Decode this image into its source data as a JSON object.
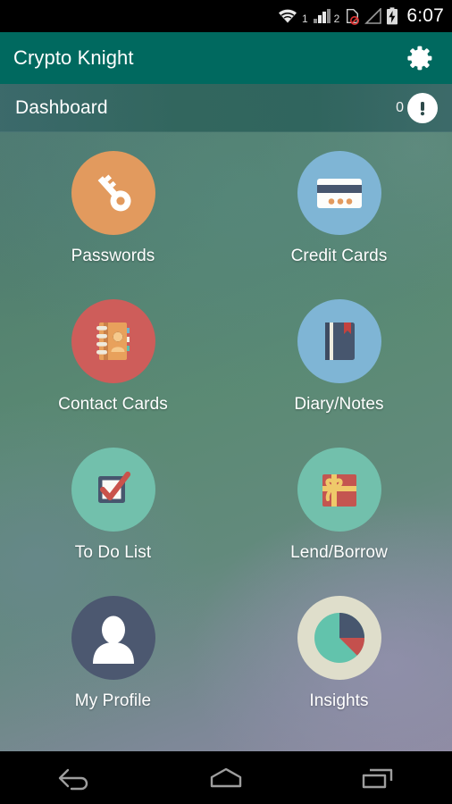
{
  "status_bar": {
    "wifi_icon": "wifi-icon",
    "sim1_label": "1",
    "sim1_signal_icon": "signal-bars-icon",
    "sim2_label": "2",
    "sim2_nosim_icon": "no-sim-card-icon",
    "signal2_icon": "signal-triangle-icon",
    "battery_icon": "battery-charging-icon",
    "clock": "6:07",
    "background_color": "#000000"
  },
  "action_bar": {
    "title": "Crypto Knight",
    "settings_icon": "gear-icon",
    "background_color": "#00695F",
    "text_color": "#FFFFFF"
  },
  "sub_header": {
    "title": "Dashboard",
    "badge_count": "0",
    "alert_icon": "exclamation-circle-icon"
  },
  "dashboard": {
    "tiles": [
      {
        "label": "Passwords",
        "icon": "key-icon",
        "circle_color": "#E29A5E",
        "glyph_color": "#FFFFFF"
      },
      {
        "label": "Credit Cards",
        "icon": "credit-card-icon",
        "circle_color": "#7FB5D5",
        "glyph_color": "#FDFDFB"
      },
      {
        "label": "Contact Cards",
        "icon": "address-book-icon",
        "circle_color": "#CE5D5A",
        "glyph_color": "#E8A15C"
      },
      {
        "label": "Diary/Notes",
        "icon": "notebook-bookmark-icon",
        "circle_color": "#7FB5D5",
        "glyph_color": "#47566E"
      },
      {
        "label": "To Do List",
        "icon": "checkbox-checked-icon",
        "circle_color": "#72C0AC",
        "glyph_color": "#C9524B"
      },
      {
        "label": "Lend/Borrow",
        "icon": "gift-box-icon",
        "circle_color": "#72C0AC",
        "glyph_color": "#C45550"
      },
      {
        "label": "My Profile",
        "icon": "person-avatar-icon",
        "circle_color": "#4C5870",
        "glyph_color": "#FFFFFF"
      },
      {
        "label": "Insights",
        "icon": "pie-chart-icon",
        "circle_color": "#DFDECB",
        "glyph_color": "#62C3AC"
      }
    ]
  },
  "nav_bar": {
    "back_icon": "back-arrow-icon",
    "home_icon": "home-icon",
    "recents_icon": "recent-apps-icon",
    "background_color": "#000000",
    "icon_color": "#9E9E9E"
  }
}
